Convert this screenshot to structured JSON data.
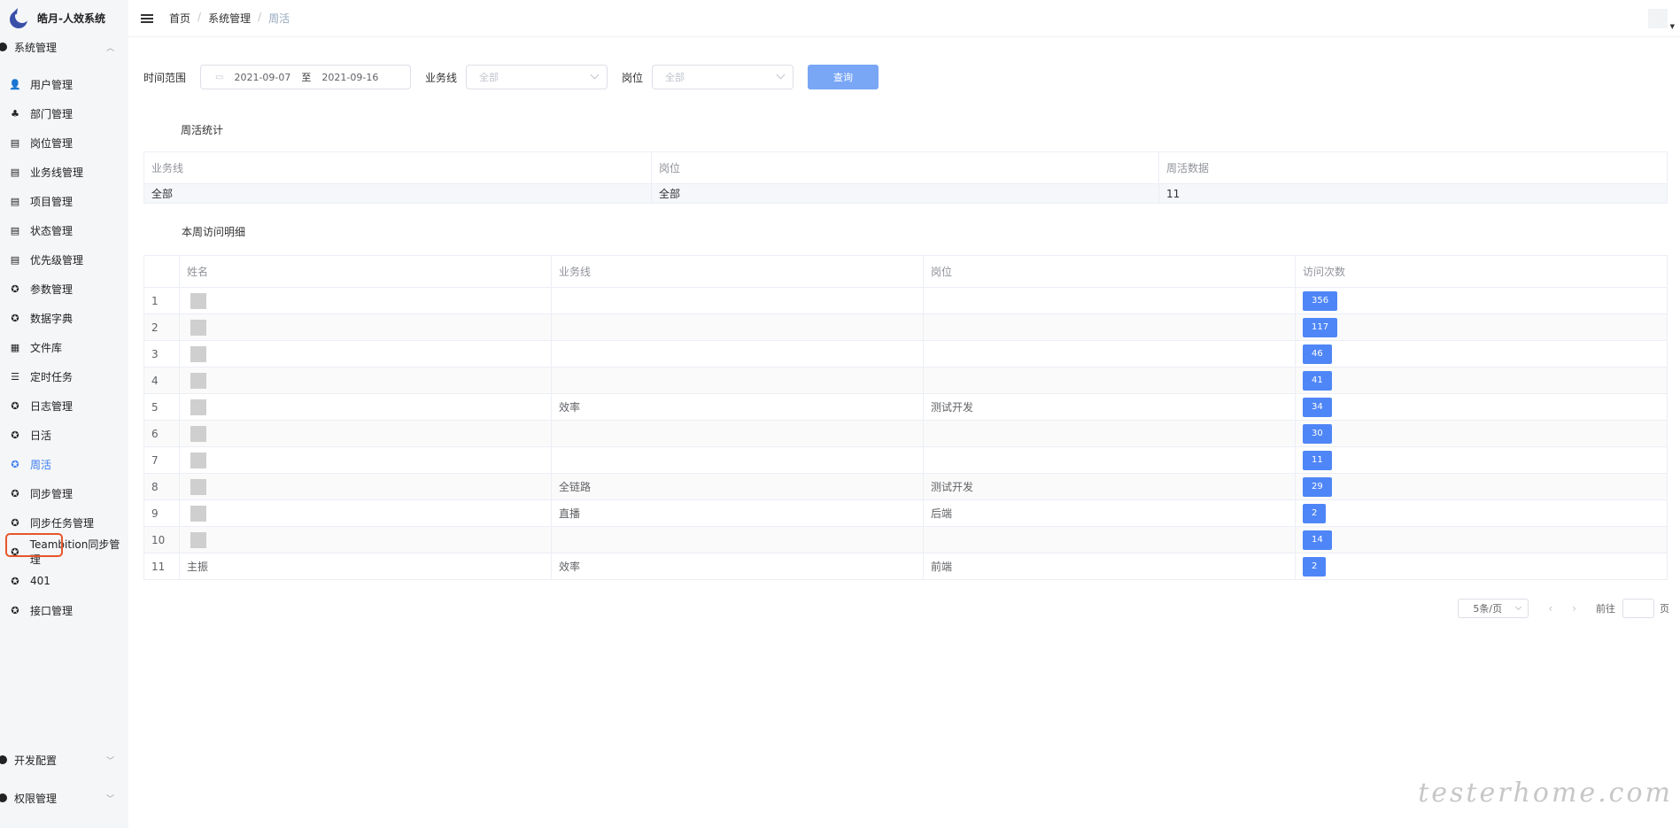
{
  "app": {
    "title": "皓月-人效系统"
  },
  "sidebar": {
    "group_system": "系统管理",
    "items": [
      {
        "label": "用户管理",
        "icon": "user-icon",
        "glyph": "👤"
      },
      {
        "label": "部门管理",
        "icon": "org-chart-icon",
        "glyph": "♣"
      },
      {
        "label": "岗位管理",
        "icon": "briefcase-icon",
        "glyph": "▤"
      },
      {
        "label": "业务线管理",
        "icon": "briefcase-icon",
        "glyph": "▤"
      },
      {
        "label": "项目管理",
        "icon": "briefcase-icon",
        "glyph": "▤"
      },
      {
        "label": "状态管理",
        "icon": "briefcase-icon",
        "glyph": "▤"
      },
      {
        "label": "优先级管理",
        "icon": "briefcase-icon",
        "glyph": "▤"
      },
      {
        "label": "参数管理",
        "icon": "gear-icon",
        "glyph": "✪"
      },
      {
        "label": "数据字典",
        "icon": "gear-icon",
        "glyph": "✪"
      },
      {
        "label": "文件库",
        "icon": "file-icon",
        "glyph": "▦"
      },
      {
        "label": "定时任务",
        "icon": "list-icon",
        "glyph": "☰"
      },
      {
        "label": "日志管理",
        "icon": "gear-icon",
        "glyph": "✪"
      },
      {
        "label": "日活",
        "icon": "gear-icon",
        "glyph": "✪"
      },
      {
        "label": "周活",
        "icon": "gear-icon",
        "glyph": "✪",
        "active": true
      },
      {
        "label": "同步管理",
        "icon": "gear-icon",
        "glyph": "✪"
      },
      {
        "label": "同步任务管理",
        "icon": "gear-icon",
        "glyph": "✪"
      },
      {
        "label": "Teambition同步管理",
        "icon": "gear-icon",
        "glyph": "✪"
      },
      {
        "label": "401",
        "icon": "gear-icon",
        "glyph": "✪"
      },
      {
        "label": "接口管理",
        "icon": "gear-icon",
        "glyph": "✪"
      }
    ],
    "group_dev": "开发配置",
    "group_perm": "权限管理"
  },
  "breadcrumb": [
    "首页",
    "系统管理",
    "周活"
  ],
  "filter": {
    "time_label": "时间范围",
    "date_start": "2021-09-07",
    "date_to": "至",
    "date_end": "2021-09-16",
    "business_label": "业务线",
    "business_value": "全部",
    "position_label": "岗位",
    "position_value": "全部",
    "query_button": "查询"
  },
  "stats": {
    "title": "周活统计",
    "columns": [
      "业务线",
      "岗位",
      "周活数据"
    ],
    "row": [
      "全部",
      "全部",
      "11"
    ]
  },
  "detail": {
    "title": "本周访问明细",
    "columns": [
      "",
      "姓名",
      "业务线",
      "岗位",
      "访问次数"
    ],
    "rows": [
      {
        "idx": "1",
        "name": "",
        "business": "",
        "position": "",
        "visits": "356"
      },
      {
        "idx": "2",
        "name": "",
        "business": "",
        "position": "",
        "visits": "117"
      },
      {
        "idx": "3",
        "name": "",
        "business": "",
        "position": "",
        "visits": "46"
      },
      {
        "idx": "4",
        "name": "",
        "business": "",
        "position": "",
        "visits": "41"
      },
      {
        "idx": "5",
        "name": "",
        "business": "效率",
        "position": "测试开发",
        "visits": "34"
      },
      {
        "idx": "6",
        "name": "",
        "business": "",
        "position": "",
        "visits": "30"
      },
      {
        "idx": "7",
        "name": "",
        "business": "",
        "position": "",
        "visits": "11"
      },
      {
        "idx": "8",
        "name": "",
        "business": "全链路",
        "position": "测试开发",
        "visits": "29"
      },
      {
        "idx": "9",
        "name": "",
        "business": "直播",
        "position": "后端",
        "visits": "2"
      },
      {
        "idx": "10",
        "name": "",
        "business": "",
        "position": "",
        "visits": "14"
      },
      {
        "idx": "11",
        "name": "主振",
        "business": "效率",
        "position": "前端",
        "visits": "2"
      }
    ]
  },
  "pager": {
    "page_size": "5条/页",
    "goto_label": "前往",
    "page_unit": "页"
  },
  "watermark": "testerhome.com"
}
